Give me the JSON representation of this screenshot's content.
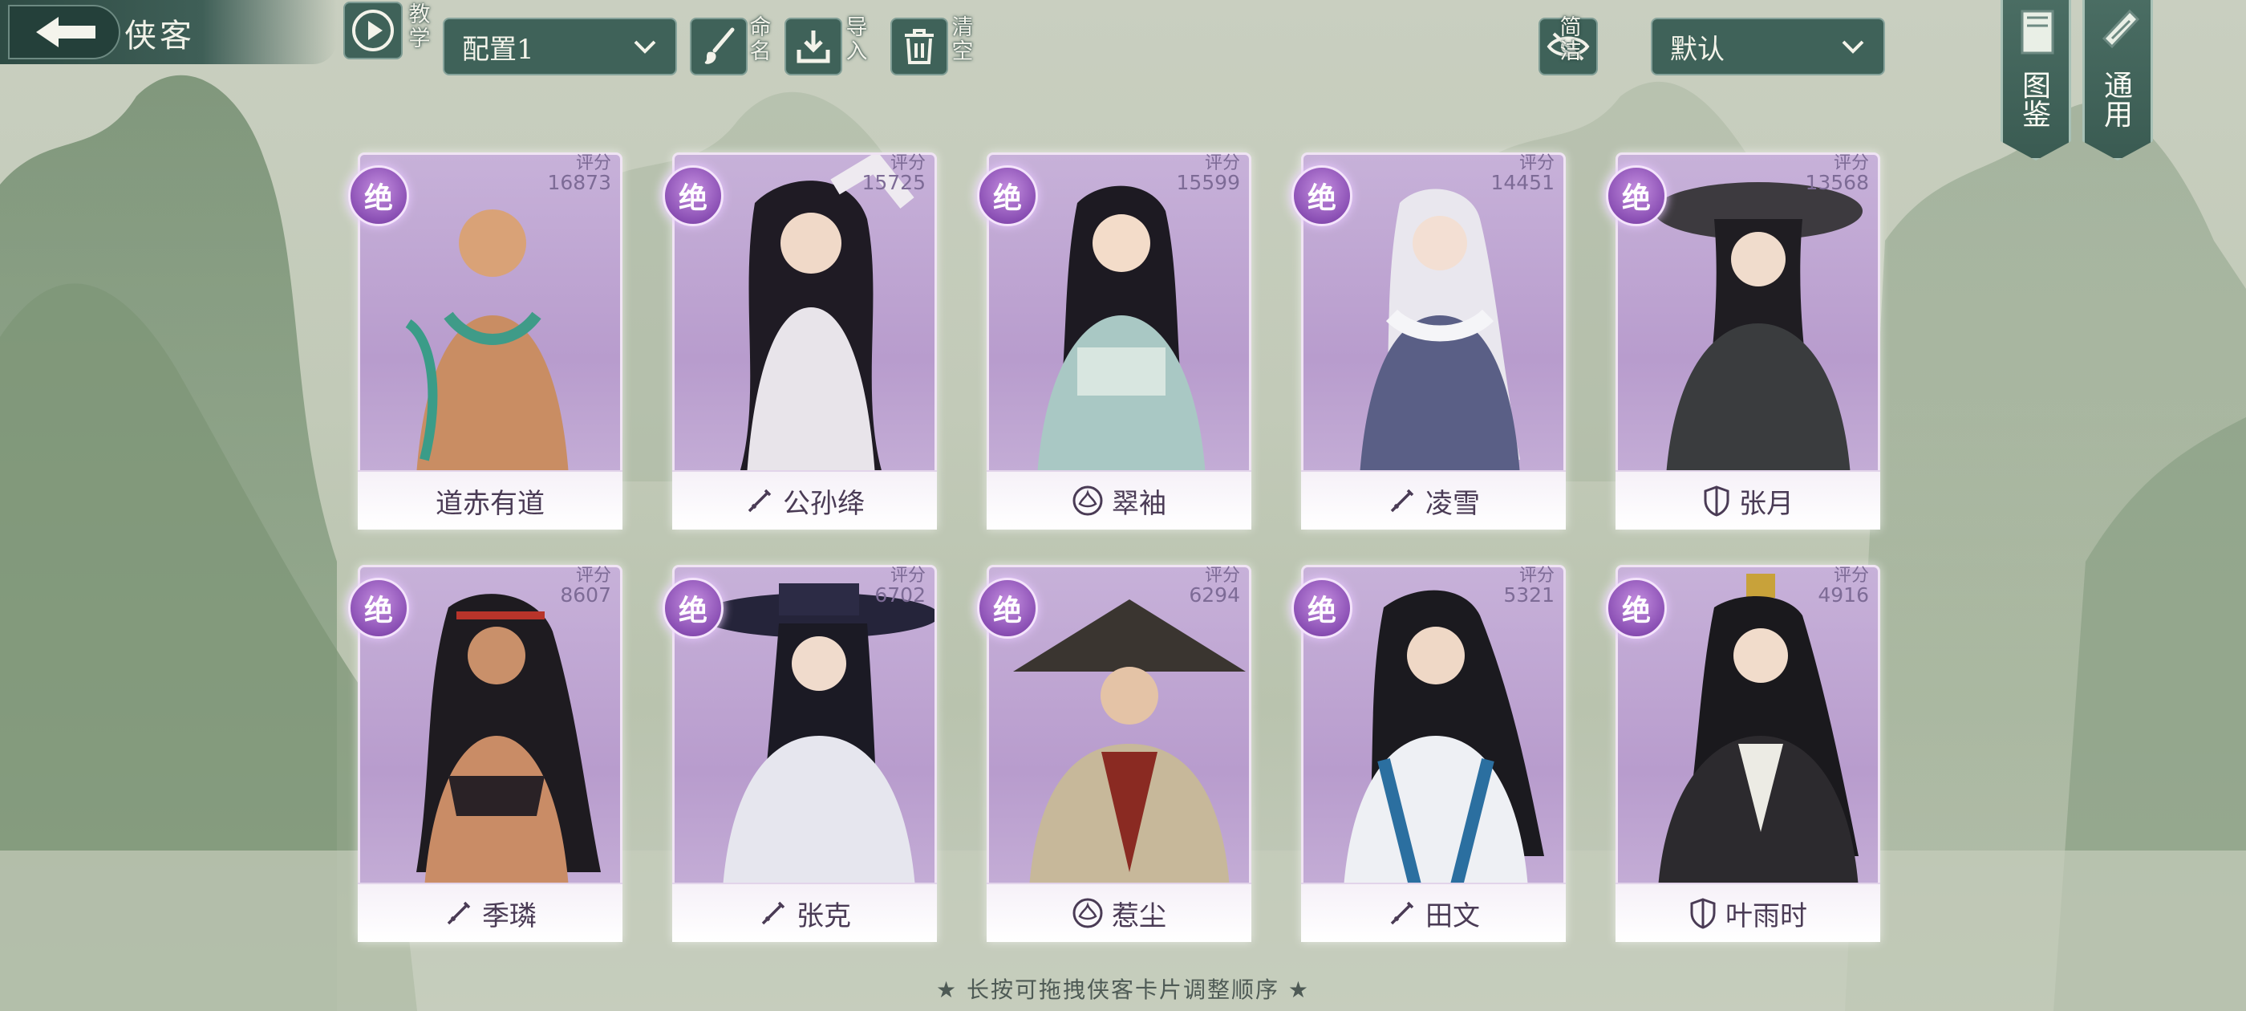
{
  "header": {
    "title": "侠客",
    "tutorial_label": "教学",
    "config_select": {
      "value": "配置1"
    },
    "rename_label": "命名",
    "import_label": "导入",
    "clear_label": "清空",
    "simple_label": "简洁",
    "sort_select": {
      "value": "默认"
    },
    "atlas_label": "图鉴",
    "common_label": "通用"
  },
  "cards": [
    {
      "name": "道赤有道",
      "score_label": "评分",
      "score": "16873",
      "rank": "绝",
      "faction_icon": "none"
    },
    {
      "name": "公孙绛",
      "score_label": "评分",
      "score": "15725",
      "rank": "绝",
      "faction_icon": "sword-icon"
    },
    {
      "name": "翠袖",
      "score_label": "评分",
      "score": "15599",
      "rank": "绝",
      "faction_icon": "lotus-icon"
    },
    {
      "name": "凌雪",
      "score_label": "评分",
      "score": "14451",
      "rank": "绝",
      "faction_icon": "sword-icon"
    },
    {
      "name": "张月",
      "score_label": "评分",
      "score": "13568",
      "rank": "绝",
      "faction_icon": "shield-icon"
    },
    {
      "name": "季璘",
      "score_label": "评分",
      "score": "8607",
      "rank": "绝",
      "faction_icon": "sword-icon"
    },
    {
      "name": "张克",
      "score_label": "评分",
      "score": "6702",
      "rank": "绝",
      "faction_icon": "sword-icon"
    },
    {
      "name": "惹尘",
      "score_label": "评分",
      "score": "6294",
      "rank": "绝",
      "faction_icon": "lotus-icon"
    },
    {
      "name": "田文",
      "score_label": "评分",
      "score": "5321",
      "rank": "绝",
      "faction_icon": "sword-icon"
    },
    {
      "name": "叶雨时",
      "score_label": "评分",
      "score": "4916",
      "rank": "绝",
      "faction_icon": "shield-icon"
    }
  ],
  "footer": {
    "hint": "★ 长按可拖拽侠客卡片调整顺序 ★"
  },
  "colors": {
    "accent": "#3f6259",
    "card_purple": "#b89ccd",
    "rank_purple": "#8a4fb4"
  }
}
